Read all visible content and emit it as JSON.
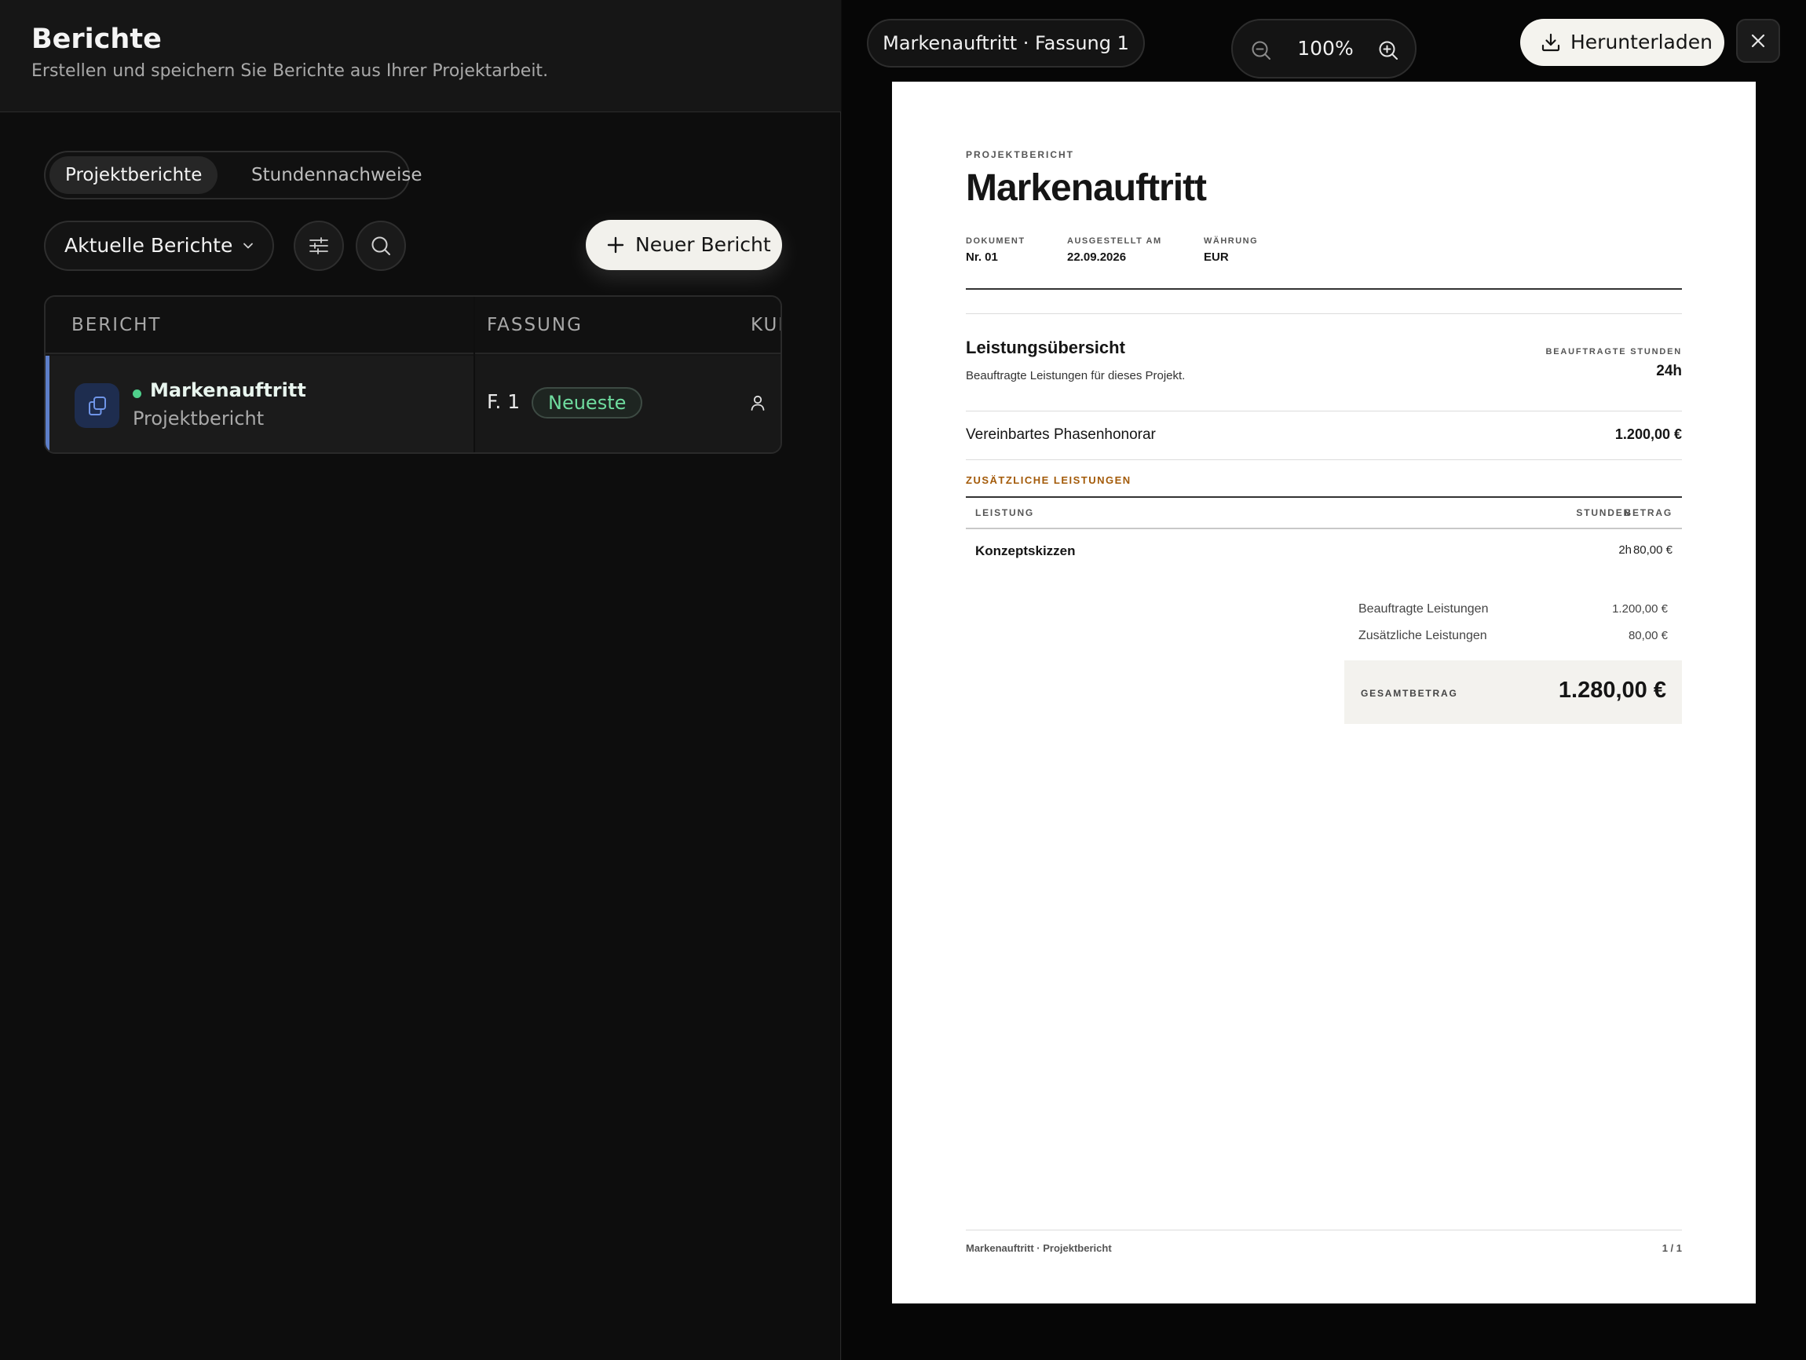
{
  "header": {
    "title": "Berichte",
    "subtitle": "Erstellen und speichern Sie Berichte aus Ihrer Projektarbeit."
  },
  "tabs": [
    {
      "label": "Projektberichte",
      "active": true
    },
    {
      "label": "Stundennachweise",
      "active": false
    }
  ],
  "toolbar": {
    "filter_select": "Aktuelle Berichte",
    "filter_icon": "sliders-icon",
    "search_icon": "search-icon",
    "new_button": "Neuer Bericht"
  },
  "table": {
    "columns": [
      "BERICHT",
      "FASSUNG",
      "KUI"
    ],
    "rows": [
      {
        "name": "Markenauftritt",
        "type": "Projektbericht",
        "version": "F. 1",
        "badge": "Neueste",
        "status_color": "#4fd08b"
      }
    ]
  },
  "viewer": {
    "doc_title": "Markenauftritt · Fassung 1",
    "zoom": "100%",
    "download": "Herunterladen"
  },
  "document": {
    "eyebrow": "PROJEKTBERICHT",
    "title": "Markenauftritt",
    "meta": [
      {
        "label": "DOKUMENT",
        "value": "Nr. 01"
      },
      {
        "label": "AUSGESTELLT AM",
        "value": "22.09.2026"
      },
      {
        "label": "WÄHRUNG",
        "value": "EUR"
      }
    ],
    "section_title": "Leistungsübersicht",
    "section_subtitle": "Beauftragte Leistungen für dieses Projekt.",
    "hours_label": "BEAUFTRAGTE STUNDEN",
    "hours_value": "24h",
    "fee_label": "Vereinbartes Phasenhonorar",
    "fee_value": "1.200,00 €",
    "additional_title": "ZUSÄTZLICHE LEISTUNGEN",
    "additional_headers": [
      "LEISTUNG",
      "STUNDEN",
      "BETRAG"
    ],
    "additional_rows": [
      {
        "name": "Konzeptskizzen",
        "hours": "2h",
        "amount": "80,00 €"
      }
    ],
    "summary": [
      {
        "label": "Beauftragte Leistungen",
        "value": "1.200,00 €"
      },
      {
        "label": "Zusätzliche Leistungen",
        "value": "80,00 €"
      }
    ],
    "total_label": "GESAMTBETRAG",
    "total_value": "1.280,00 €",
    "footer_left": "Markenauftritt · Projektbericht",
    "footer_right": "1 / 1"
  },
  "colors": {
    "accent_blue": "#5d7ec8",
    "status_green": "#4fd08b",
    "additional_heading": "#a35a08"
  }
}
